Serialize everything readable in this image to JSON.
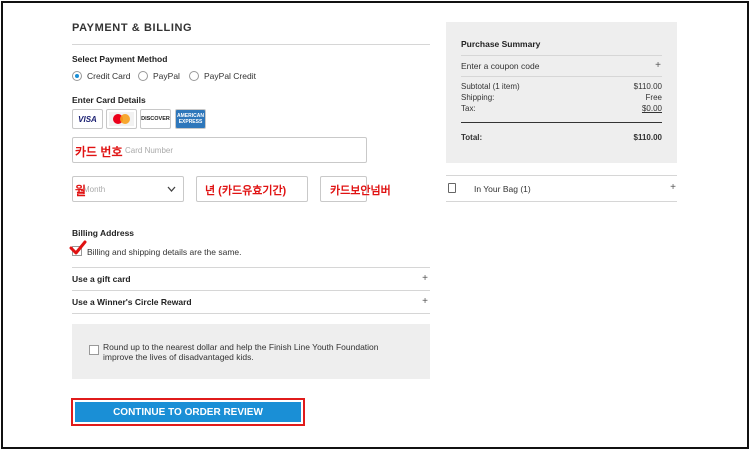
{
  "payment": {
    "title": "PAYMENT & BILLING",
    "select_method_label": "Select Payment Method",
    "methods": [
      {
        "label": "Credit Card",
        "selected": true
      },
      {
        "label": "PayPal",
        "selected": false
      },
      {
        "label": "PayPal Credit",
        "selected": false
      }
    ],
    "card_details_label": "Enter Card Details",
    "card_icons": [
      "VISA",
      "MasterCard",
      "DISCOVER",
      "AMERICAN EXPRESS"
    ],
    "card_number_placeholder": "Card Number",
    "card_number_annotation": "카드 번호",
    "month_placeholder": "Month",
    "month_annotation": "월",
    "year_annotation": "년 (카드유효기간)",
    "cvv_annotation": "카드보안넘버",
    "billing_address_label": "Billing Address",
    "billing_same_label": "Billing and shipping details are the same.",
    "gift_card_label": "Use a gift card",
    "winners_circle_label": "Use a Winner's Circle Reward",
    "expand_symbol": "+",
    "donate_text": "Round up to the nearest dollar and help the Finish Line Youth Foundation improve the lives of disadvantaged kids.",
    "continue_button": "CONTINUE TO ORDER REVIEW"
  },
  "summary": {
    "title": "Purchase Summary",
    "coupon_label": "Enter a coupon code",
    "subtotal_label": "Subtotal (1 item)",
    "subtotal_value": "$110.00",
    "shipping_label": "Shipping:",
    "shipping_value": "Free",
    "tax_label": "Tax:",
    "tax_value": "$0.00",
    "total_label": "Total:",
    "total_value": "$110.00",
    "bag_label": "In Your Bag (1)"
  },
  "colors": {
    "accent": "#1a8fd6",
    "annotation_red": "#e01212",
    "panel_bg": "#eeeeee"
  }
}
